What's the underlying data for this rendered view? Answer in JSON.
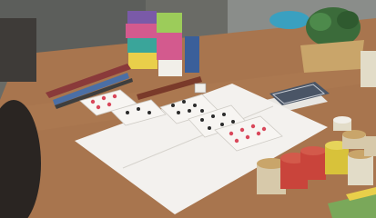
{
  "scene": {
    "palette": {
      "table": "#a8754e",
      "table_dark": "#7a5033",
      "paper": "#f3f1ee",
      "card_face": "#f7f5f2",
      "heart_red": "#d9475a",
      "club_black": "#2b2b2b",
      "deck_back": "#4a5566",
      "block_pink": "#d35a8e",
      "block_green": "#9ccc5a",
      "block_yellow": "#e9cf4a",
      "block_purple": "#7a5aa8",
      "block_teal": "#3aa59a",
      "cyl_red": "#c9443b",
      "cyl_yellow": "#d8c23a",
      "cyl_wood": "#c9a56a",
      "plant_green": "#3b6b3a",
      "background_wall": "#6f7370"
    }
  }
}
